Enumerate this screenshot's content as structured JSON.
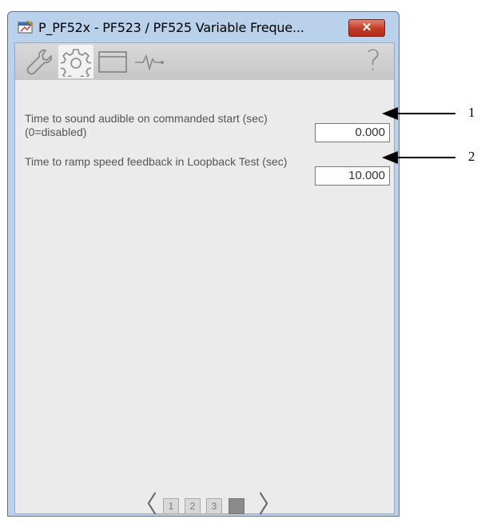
{
  "window": {
    "title": "P_PF52x - PF523 / PF525 Variable Freque...",
    "close_label": "✕"
  },
  "tabs": [
    {
      "name": "maintenance-wrench",
      "icon": "wrench-icon"
    },
    {
      "name": "configuration-gear",
      "icon": "gear-icon",
      "active": true
    },
    {
      "name": "faceplate-window",
      "icon": "window-icon"
    },
    {
      "name": "trend-pulse",
      "icon": "pulse-icon"
    }
  ],
  "help_label": "?",
  "settings": [
    {
      "label": "Time to sound audible on commanded start (sec) (0=disabled)",
      "value": "0.000"
    },
    {
      "label": "Time to ramp speed feedback in Loopback Test (sec)",
      "value": "10.000"
    }
  ],
  "pager": {
    "prev": "〈",
    "next": "〉",
    "pages": [
      "1",
      "2",
      "3",
      "4"
    ],
    "current_page": 4
  },
  "callouts": [
    "1",
    "2"
  ]
}
